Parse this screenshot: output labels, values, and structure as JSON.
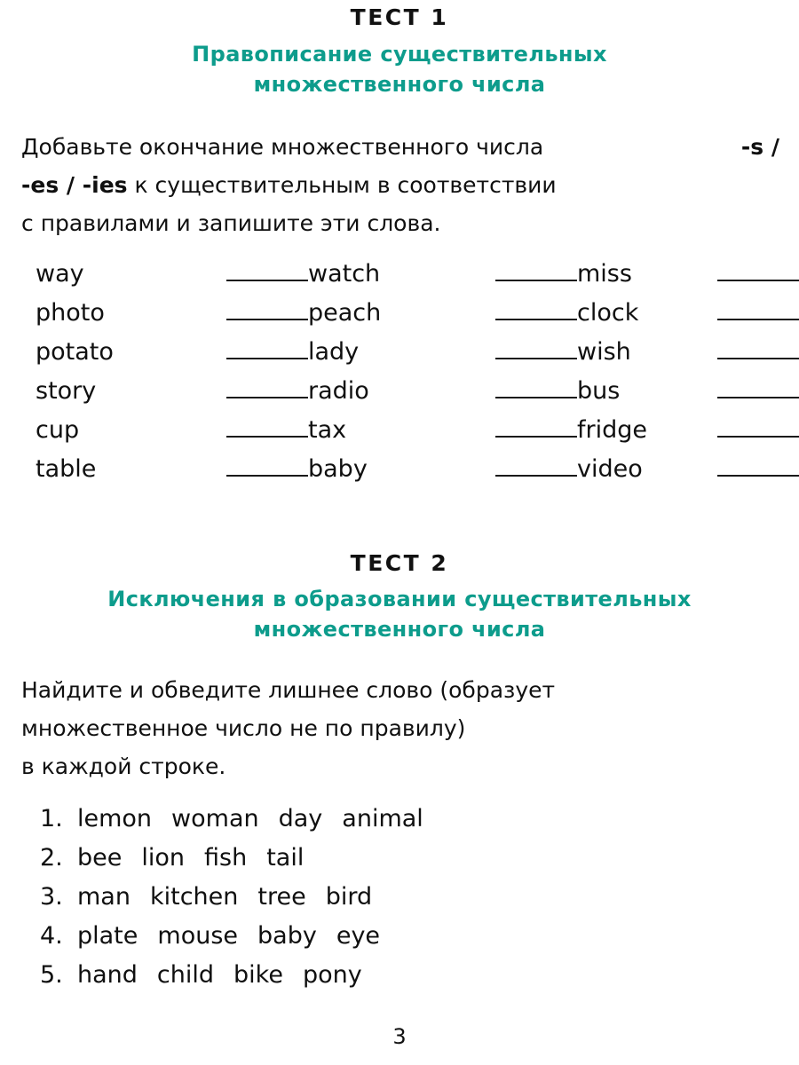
{
  "colors": {
    "heading_accent": "#0d9c8c",
    "text": "#101010",
    "rule": "#1a1a1a",
    "background": "#ffffff"
  },
  "test1": {
    "number_label": "ТЕСТ 1",
    "title_line1": "Правописание существительных",
    "title_line2": "множественного числа",
    "instruction": {
      "line1_plain_a": "Добавьте окончание множественного числа ",
      "line1_bold": "-s /",
      "line2_bold": "-es / -ies",
      "line2_plain": " к существительным в соответствии",
      "line3_plain": "с правилами и запишите эти слова."
    },
    "columns": [
      {
        "words": [
          "way",
          "photo",
          "potato",
          "story",
          "cup",
          "table"
        ]
      },
      {
        "words": [
          "watch",
          "peach",
          "lady",
          "radio",
          "tax",
          "baby"
        ]
      },
      {
        "words": [
          "miss",
          "clock",
          "wish",
          "bus",
          "fridge",
          "video"
        ]
      }
    ]
  },
  "test2": {
    "number_label": "ТЕСТ 2",
    "title_line1": "Исключения в образовании существительных",
    "title_line2": "множественного числа",
    "instruction": {
      "line1": "Найдите и обведите лишнее слово (образует",
      "line2": "множественное число не по правилу)",
      "line3": "в каждой строке."
    },
    "items": [
      {
        "index": "1.",
        "words": [
          "lemon",
          "woman",
          "day",
          "animal"
        ]
      },
      {
        "index": "2.",
        "words": [
          "bee",
          "lion",
          "fish",
          "tail"
        ]
      },
      {
        "index": "3.",
        "words": [
          "man",
          "kitchen",
          "tree",
          "bird"
        ]
      },
      {
        "index": "4.",
        "words": [
          "plate",
          "mouse",
          "baby",
          "eye"
        ]
      },
      {
        "index": "5.",
        "words": [
          "hand",
          "child",
          "bike",
          "pony"
        ]
      }
    ]
  },
  "footer": {
    "page_number": "3"
  }
}
